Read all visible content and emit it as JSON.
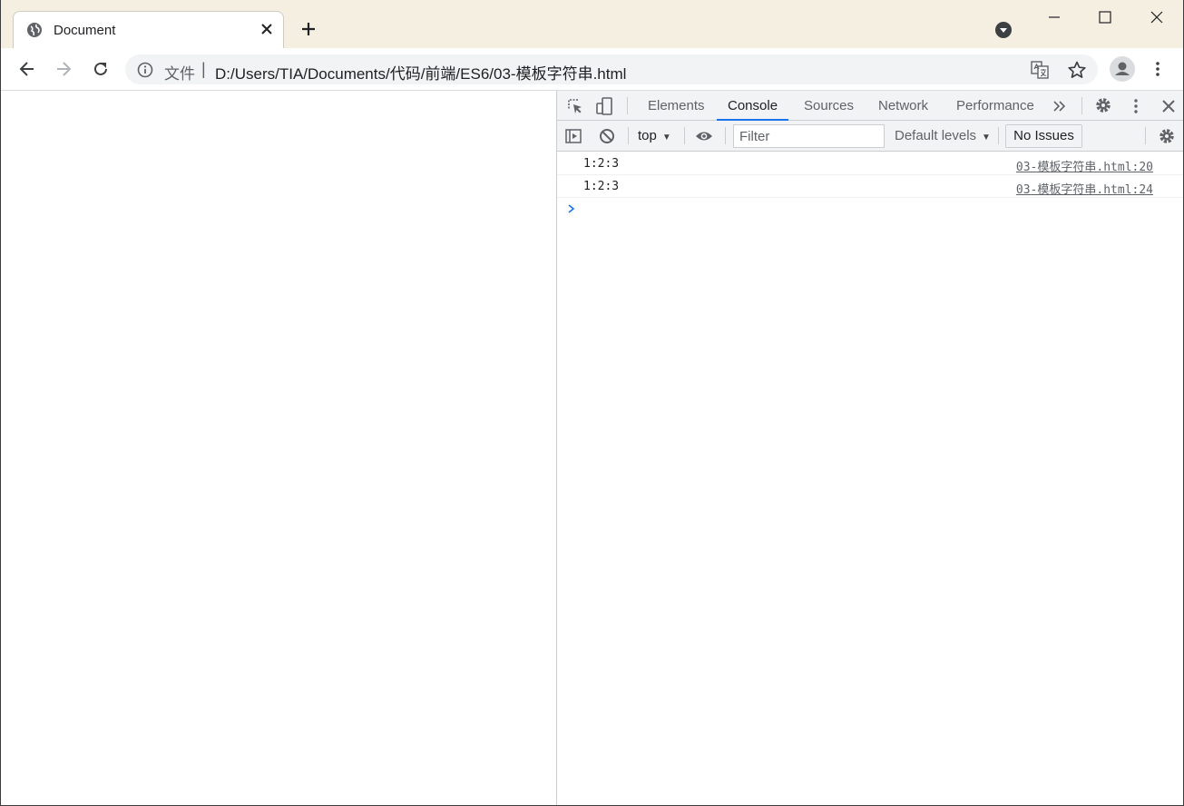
{
  "browser": {
    "tab_title": "Document",
    "scheme_label": "文件",
    "scheme_separator": "|",
    "url": "D:/Users/TIA/Documents/代码/前端/ES6/03-模板字符串.html"
  },
  "devtools": {
    "tabs": [
      {
        "label": "Elements",
        "active": false
      },
      {
        "label": "Console",
        "active": true
      },
      {
        "label": "Sources",
        "active": false
      },
      {
        "label": "Network",
        "active": false
      },
      {
        "label": "Performance",
        "active": false
      }
    ],
    "console_bar": {
      "context": "top",
      "filter_placeholder": "Filter",
      "levels": "Default levels",
      "issues": "No Issues"
    },
    "logs": [
      {
        "message": "1:2:3",
        "source": "03-模板字符串.html:20"
      },
      {
        "message": "1:2:3",
        "source": "03-模板字符串.html:24"
      }
    ]
  },
  "colors": {
    "titlebar": "#f5efe1",
    "accent": "#1a73e8",
    "panel": "#f1f3f4"
  },
  "icons": [
    "globe-icon",
    "close-icon",
    "plus-icon",
    "back-arrow-icon",
    "forward-arrow-icon",
    "reload-icon",
    "info-icon",
    "translate-icon",
    "star-icon",
    "profile-icon",
    "kebab-menu-icon",
    "inspect-icon",
    "device-toggle-icon",
    "more-tabs-icon",
    "gear-icon",
    "sidebar-icon",
    "clear-icon",
    "eye-icon"
  ]
}
